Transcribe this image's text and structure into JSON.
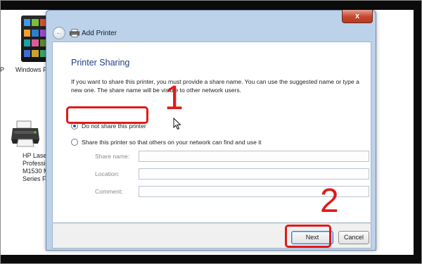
{
  "desktop": {
    "windows_phone_label": "Windows P",
    "left_clip": "P",
    "printer_label_lines": [
      "HP Laser",
      "Professio",
      "M1530 M",
      "Series F"
    ]
  },
  "dialog": {
    "title": "Add Printer",
    "close_glyph": "x",
    "back_glyph": "←",
    "heading": "Printer Sharing",
    "description": "If you want to share this printer, you must provide a share name. You can use the suggested name or type a new one. The share name will be visible to other network users.",
    "options": [
      {
        "label": "Do not share this printer",
        "selected": true
      },
      {
        "label": "Share this printer so that others on your network can find and use it",
        "selected": false
      }
    ],
    "fields": {
      "share_name": {
        "label": "Share name:",
        "value": ""
      },
      "location": {
        "label": "Location:",
        "value": ""
      },
      "comment": {
        "label": "Comment:",
        "value": ""
      }
    },
    "buttons": {
      "next": "Next",
      "cancel": "Cancel"
    }
  },
  "annotations": {
    "step1": "1",
    "step2": "2",
    "color": "#e01a1a"
  }
}
